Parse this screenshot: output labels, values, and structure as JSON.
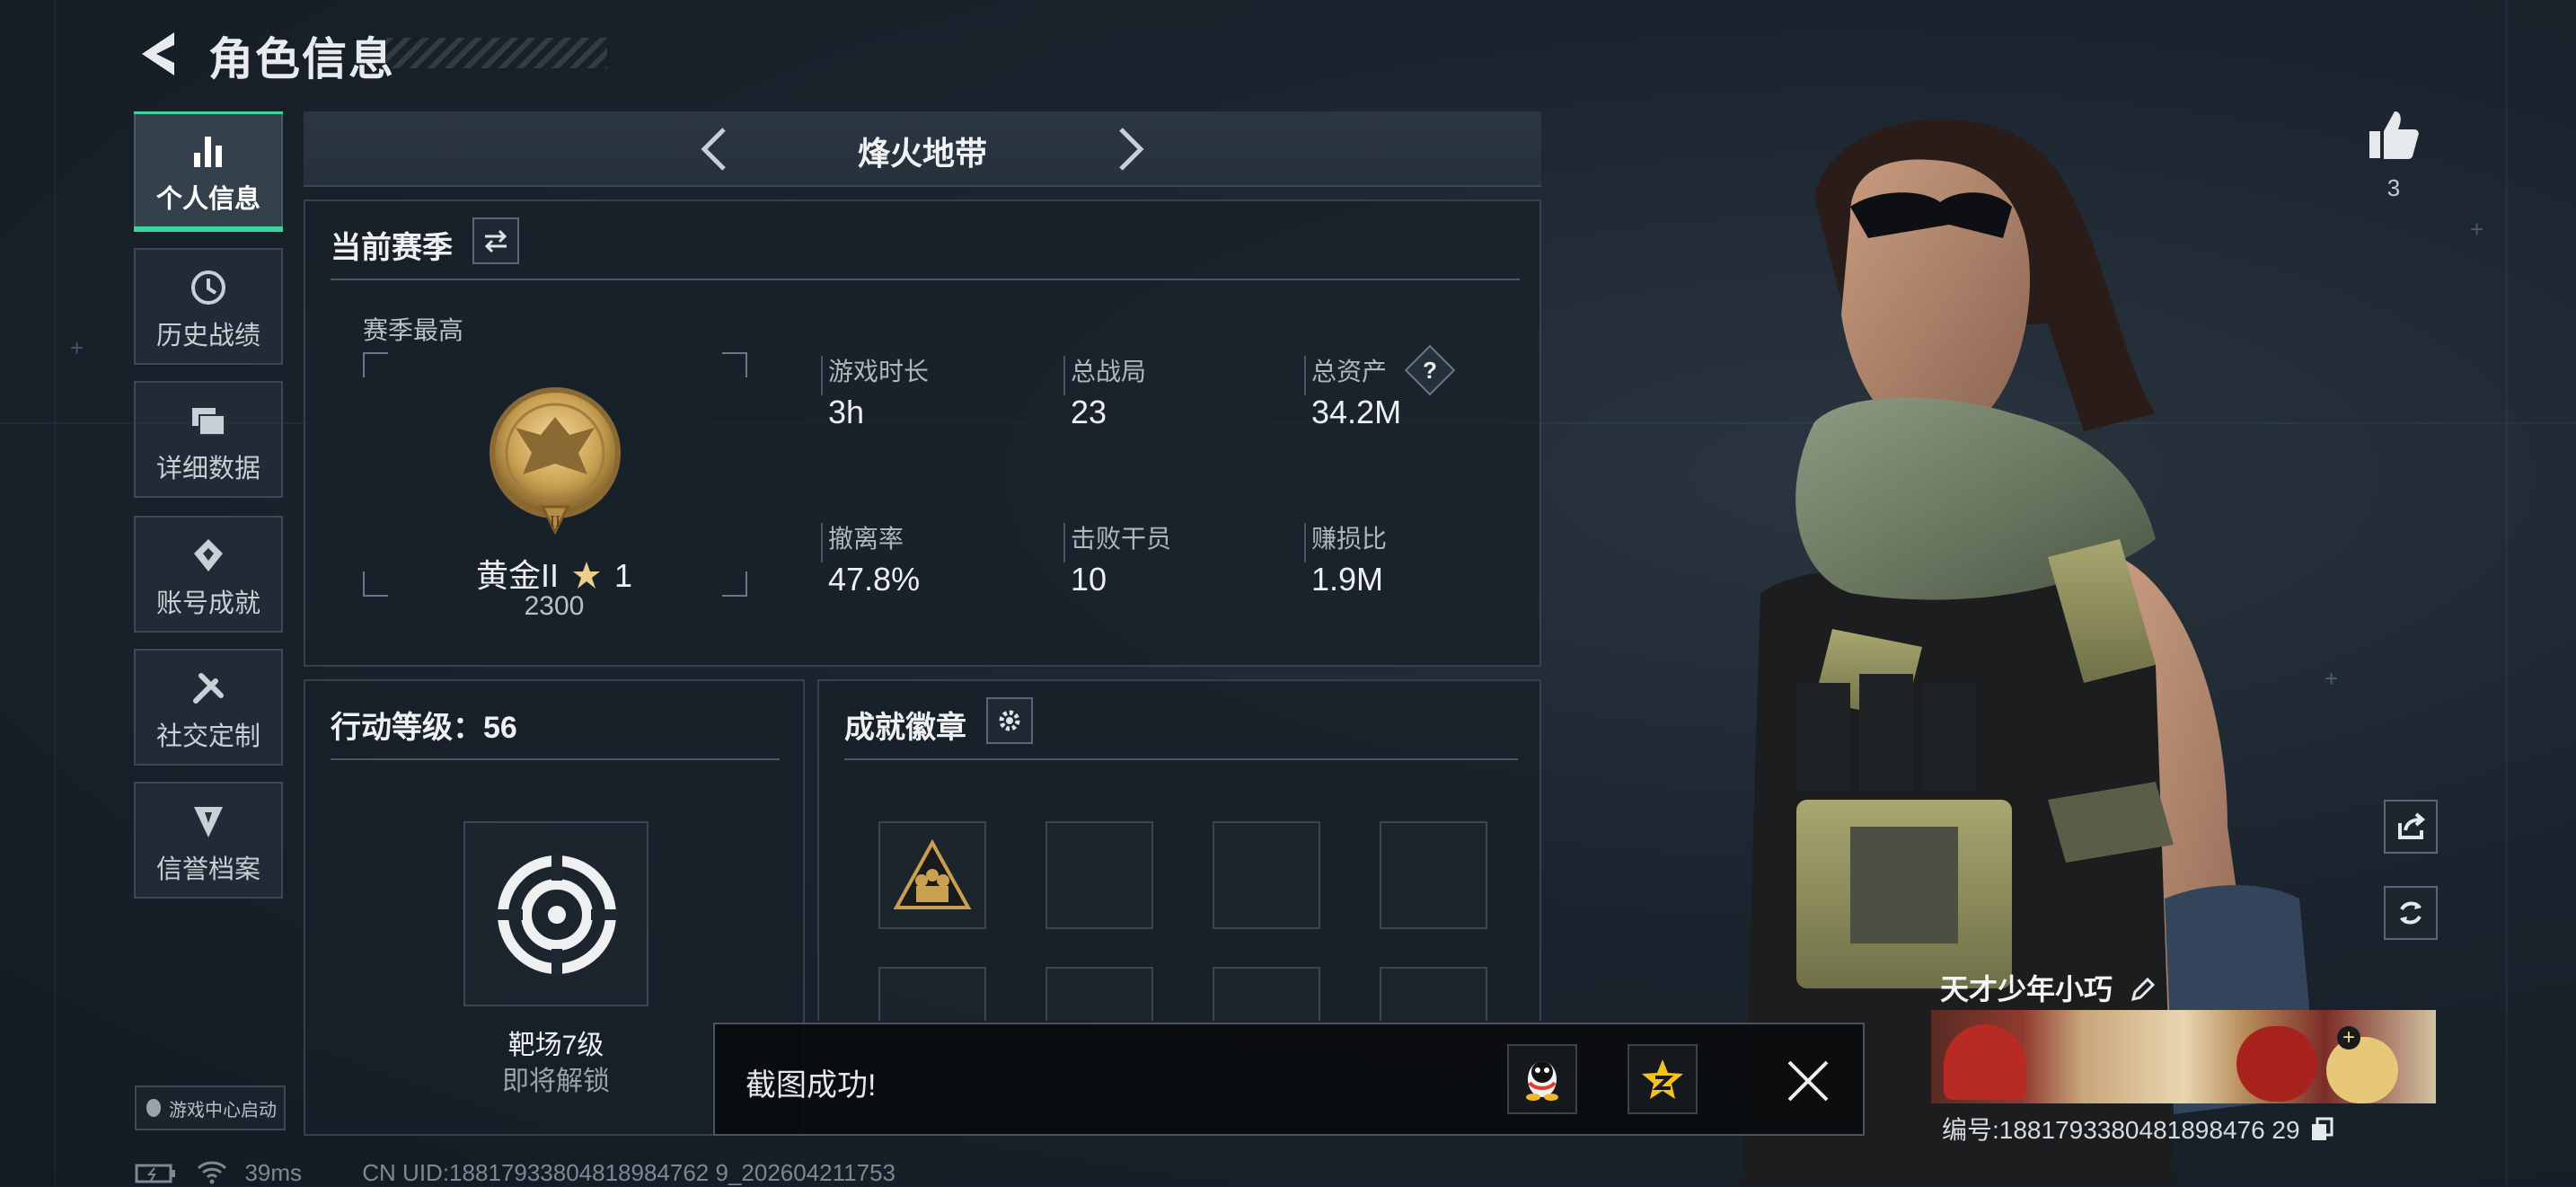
{
  "header": {
    "title": "角色信息"
  },
  "sidebar": {
    "items": [
      {
        "label": "个人信息",
        "active": true,
        "icon": "bar-chart-icon"
      },
      {
        "label": "历史战绩",
        "active": false,
        "icon": "history-icon"
      },
      {
        "label": "详细数据",
        "active": false,
        "icon": "folder-icon"
      },
      {
        "label": "账号成就",
        "active": false,
        "icon": "achievement-icon"
      },
      {
        "label": "社交定制",
        "active": false,
        "icon": "tools-icon"
      },
      {
        "label": "信誉档案",
        "active": false,
        "icon": "credit-shield-icon"
      }
    ],
    "launch_badge": "游戏中心启动"
  },
  "mode": {
    "title": "烽火地带"
  },
  "season": {
    "title": "当前赛季",
    "best_label": "赛季最高",
    "rank_name": "黄金II",
    "rank_stars": "1",
    "rank_points": "2300",
    "stats": [
      {
        "label": "游戏时长",
        "value": "3h"
      },
      {
        "label": "总战局",
        "value": "23"
      },
      {
        "label": "总资产",
        "value": "34.2M",
        "help": "?"
      },
      {
        "label": "撤离率",
        "value": "47.8%"
      },
      {
        "label": "击败干员",
        "value": "10"
      },
      {
        "label": "赚损比",
        "value": "1.9M"
      }
    ]
  },
  "level": {
    "title": "行动等级：56",
    "item_name": "靶场7级",
    "item_status": "即将解锁"
  },
  "badges": {
    "title": "成就徽章"
  },
  "toast": {
    "text": "截图成功!"
  },
  "profile": {
    "likes": "3",
    "name": "天才少年小巧",
    "uid": "编号:1881793380481898476 29"
  },
  "status": {
    "ping": "39ms",
    "uid_line": "CN UID:18817933804818984762 9_202604211753"
  },
  "colors": {
    "accent": "#36d6a0",
    "panel_bg": "#18202a",
    "gold": "#c9a052"
  }
}
